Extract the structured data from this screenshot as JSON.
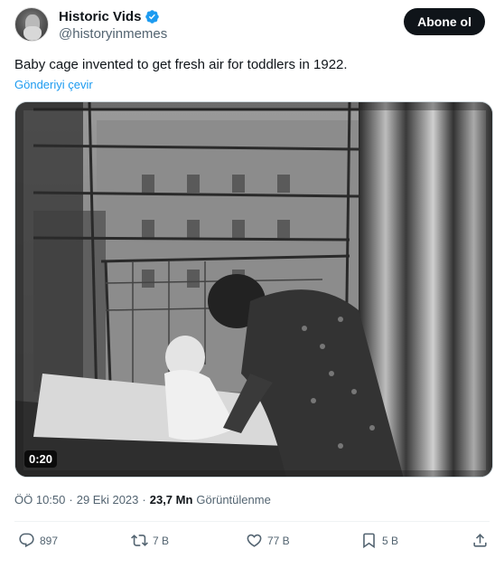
{
  "tweet": {
    "author": {
      "display_name": "Historic Vids",
      "handle": "@historyinmemes",
      "verified": true
    },
    "follow_label": "Abone ol",
    "text": "Baby cage invented to get fresh air for toddlers in 1922.",
    "translate_label": "Gönderiyi çevir",
    "media": {
      "type": "video",
      "duration": "0:20"
    },
    "meta": {
      "time": "ÖÖ 10:50",
      "separator": "·",
      "date": "29 Eki 2023",
      "separator2": "·",
      "views": "23,7 Mn",
      "views_label": "Görüntülenme"
    },
    "actions": {
      "replies": "897",
      "retweets": "7 B",
      "likes": "77 B",
      "bookmarks": "5 B"
    }
  },
  "colors": {
    "accent": "#1d9bf0",
    "text": "#0f1419",
    "secondary": "#536471",
    "follow_bg": "#0f1419"
  }
}
